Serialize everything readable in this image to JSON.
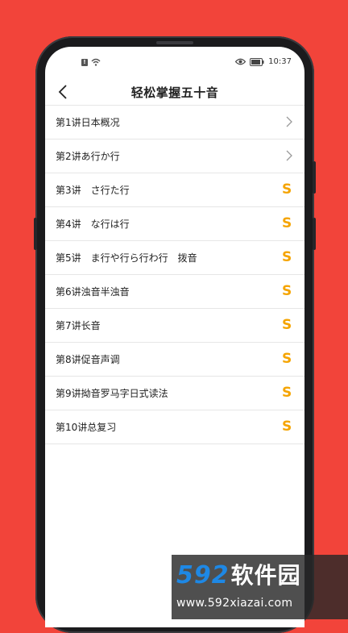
{
  "status": {
    "time": "10:37",
    "sim_badge": "!"
  },
  "header": {
    "title": "轻松掌握五十音"
  },
  "lessons": [
    {
      "label": "第1讲日本概况",
      "trailing": "chevron"
    },
    {
      "label": "第2讲あ行か行",
      "trailing": "chevron"
    },
    {
      "label": "第3讲　さ行た行",
      "trailing": "coin"
    },
    {
      "label": "第4讲　な行は行",
      "trailing": "coin"
    },
    {
      "label": "第5讲　ま行や行ら行わ行　拨音",
      "trailing": "coin"
    },
    {
      "label": "第6讲浊音半浊音",
      "trailing": "coin"
    },
    {
      "label": "第7讲长音",
      "trailing": "coin"
    },
    {
      "label": "第8讲促音声调",
      "trailing": "coin"
    },
    {
      "label": "第9讲拗音罗马字日式读法",
      "trailing": "coin"
    },
    {
      "label": "第10讲总复习",
      "trailing": "coin"
    }
  ],
  "coin_symbol": "S",
  "watermark": {
    "logo_number": "592",
    "logo_text": "软件园",
    "url": "www.592xiazai.com"
  },
  "colors": {
    "background": "#f2443a",
    "coin": "#f5a400",
    "logo_blue": "#1e88e5"
  }
}
